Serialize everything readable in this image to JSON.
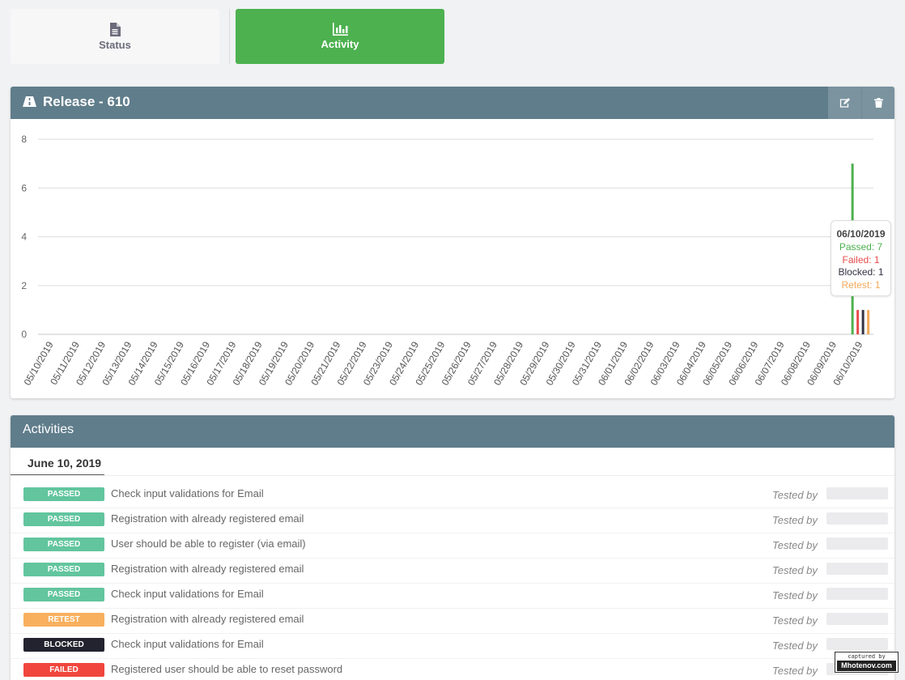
{
  "tabs": [
    {
      "label": "Status",
      "icon": "document-icon"
    },
    {
      "label": "Activity",
      "icon": "bar-chart-icon"
    }
  ],
  "release": {
    "title": "Release - 610",
    "icon": "road-icon",
    "actions": [
      "edit-icon",
      "trash-icon"
    ]
  },
  "chart_data": {
    "type": "bar",
    "categories": [
      "05/10/2019",
      "05/11/2019",
      "05/12/2019",
      "05/13/2019",
      "05/14/2019",
      "05/15/2019",
      "05/16/2019",
      "05/17/2019",
      "05/18/2019",
      "05/19/2019",
      "05/20/2019",
      "05/21/2019",
      "05/22/2019",
      "05/23/2019",
      "05/24/2019",
      "05/25/2019",
      "05/26/2019",
      "05/27/2019",
      "05/28/2019",
      "05/29/2019",
      "05/30/2019",
      "05/31/2019",
      "06/01/2019",
      "06/02/2019",
      "06/03/2019",
      "06/04/2019",
      "06/05/2019",
      "06/06/2019",
      "06/07/2019",
      "06/08/2019",
      "06/09/2019",
      "06/10/2019"
    ],
    "series": [
      {
        "name": "Passed",
        "color": "#4db14f",
        "values": [
          0,
          0,
          0,
          0,
          0,
          0,
          0,
          0,
          0,
          0,
          0,
          0,
          0,
          0,
          0,
          0,
          0,
          0,
          0,
          0,
          0,
          0,
          0,
          0,
          0,
          0,
          0,
          0,
          0,
          0,
          0,
          7
        ]
      },
      {
        "name": "Failed",
        "color": "#e84c4c",
        "values": [
          0,
          0,
          0,
          0,
          0,
          0,
          0,
          0,
          0,
          0,
          0,
          0,
          0,
          0,
          0,
          0,
          0,
          0,
          0,
          0,
          0,
          0,
          0,
          0,
          0,
          0,
          0,
          0,
          0,
          0,
          0,
          1
        ]
      },
      {
        "name": "Blocked",
        "color": "#333344",
        "values": [
          0,
          0,
          0,
          0,
          0,
          0,
          0,
          0,
          0,
          0,
          0,
          0,
          0,
          0,
          0,
          0,
          0,
          0,
          0,
          0,
          0,
          0,
          0,
          0,
          0,
          0,
          0,
          0,
          0,
          0,
          0,
          1
        ]
      },
      {
        "name": "Retest",
        "color": "#f5a95b",
        "values": [
          0,
          0,
          0,
          0,
          0,
          0,
          0,
          0,
          0,
          0,
          0,
          0,
          0,
          0,
          0,
          0,
          0,
          0,
          0,
          0,
          0,
          0,
          0,
          0,
          0,
          0,
          0,
          0,
          0,
          0,
          0,
          1
        ]
      }
    ],
    "yticks": [
      0,
      2,
      4,
      6,
      8
    ],
    "ylim": [
      0,
      8
    ],
    "grid": true
  },
  "tooltip": {
    "date": "06/10/2019",
    "items": [
      {
        "text": "Passed: 7",
        "color": "#4db14f"
      },
      {
        "text": "Failed: 1",
        "color": "#e84c4c"
      },
      {
        "text": "Blocked: 1",
        "color": "#333344"
      },
      {
        "text": "Retest: 1",
        "color": "#f5a95b"
      }
    ]
  },
  "activities": {
    "title": "Activities",
    "date": "June 10, 2019",
    "tested_by_label": "Tested by",
    "rows": [
      {
        "status": "PASSED",
        "color": "#62c59e",
        "text": "Check input validations for Email"
      },
      {
        "status": "PASSED",
        "color": "#62c59e",
        "text": "Registration with already registered email"
      },
      {
        "status": "PASSED",
        "color": "#62c59e",
        "text": "User should be able to register (via email)"
      },
      {
        "status": "PASSED",
        "color": "#62c59e",
        "text": "Registration with already registered email"
      },
      {
        "status": "PASSED",
        "color": "#62c59e",
        "text": "Check input validations for Email"
      },
      {
        "status": "RETEST",
        "color": "#f8b05e",
        "text": "Registration with already registered email"
      },
      {
        "status": "BLOCKED",
        "color": "#23232f",
        "text": "Check input validations for Email"
      },
      {
        "status": "FAILED",
        "color": "#f0463e",
        "text": "Registered user should be able to reset password"
      }
    ]
  },
  "watermark": {
    "line1": "captured by",
    "line2": "Mhotenov.com"
  }
}
